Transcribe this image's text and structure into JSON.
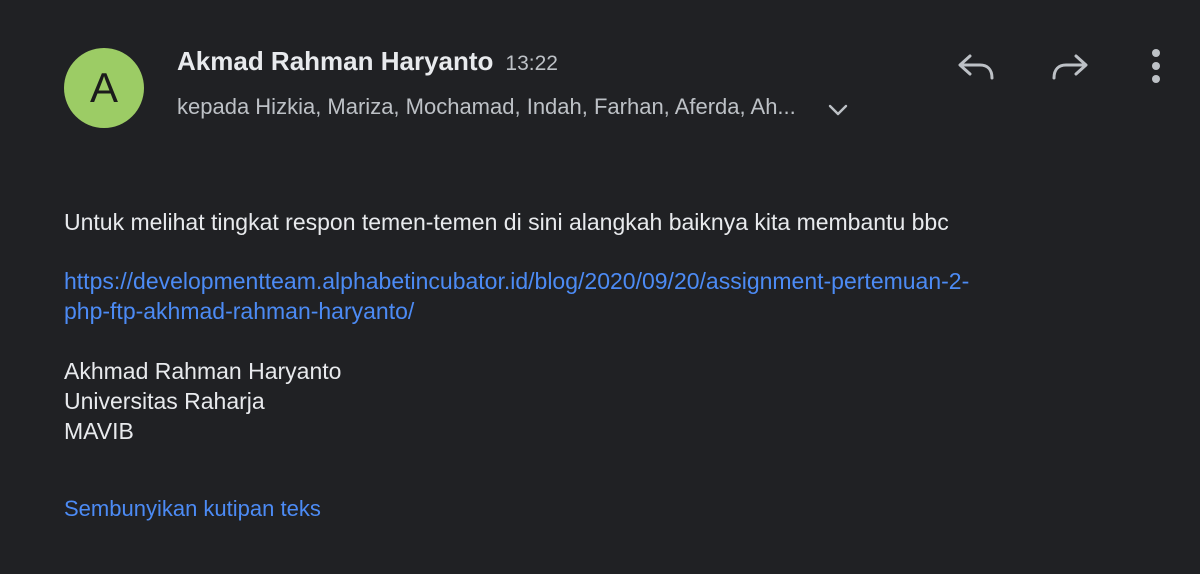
{
  "sender": {
    "avatar_letter": "A",
    "avatar_color": "#9ccc65",
    "name": "Akmad Rahman Haryanto",
    "time": "13:22",
    "recipients": "kepada Hizkia, Mariza, Mochamad, Indah, Farhan, Aferda, Ah..."
  },
  "actions": {
    "reply_icon": "reply-icon",
    "forward_icon": "forward-icon",
    "more_icon": "more-vert-icon",
    "expand_icon": "chevron-down-icon"
  },
  "body": {
    "line1": "Untuk melihat tingkat respon temen-temen di sini alangkah baiknya kita membantu bbc",
    "link_line1": "https://developmentteam.alphabetincubator.id/blog/2020/09/20/assignment-pertemuan-2-",
    "link_line2": "php-ftp-akhmad-rahman-haryanto/",
    "signature": {
      "name": "Akhmad Rahman Haryanto",
      "org": "Universitas Raharja",
      "group": "MAVIB"
    }
  },
  "hide_quote_label": "Sembunyikan kutipan teks",
  "colors": {
    "background": "#202124",
    "link": "#4c8bf5",
    "text": "#e8eaed",
    "muted": "#bdc1c6"
  }
}
